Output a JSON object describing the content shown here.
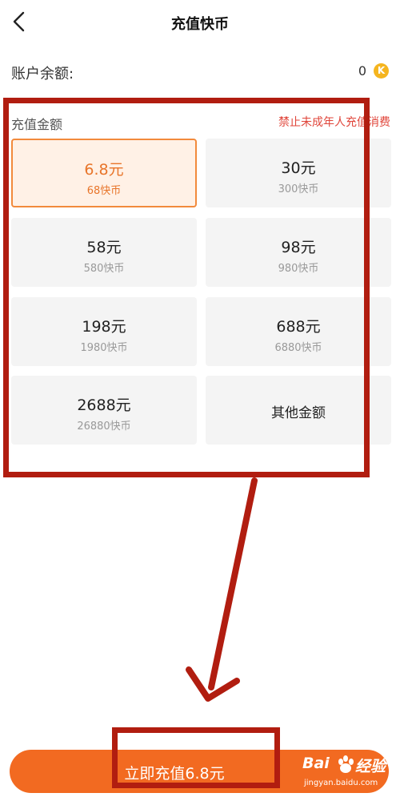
{
  "header": {
    "title": "充值快币",
    "back_icon": "chevron-left-icon"
  },
  "balance": {
    "label": "账户余额:",
    "value": "0",
    "coin_symbol": "K"
  },
  "section": {
    "label": "充值金额",
    "warning": "禁止未成年人充值消费"
  },
  "options": [
    {
      "amount": "6.8元",
      "coins": "68快币",
      "selected": true
    },
    {
      "amount": "30元",
      "coins": "300快币"
    },
    {
      "amount": "58元",
      "coins": "580快币"
    },
    {
      "amount": "98元",
      "coins": "980快币"
    },
    {
      "amount": "198元",
      "coins": "1980快币"
    },
    {
      "amount": "688元",
      "coins": "6880快币"
    },
    {
      "amount": "2688元",
      "coins": "26880快币"
    },
    {
      "other_label": "其他金额"
    }
  ],
  "recharge_button": {
    "label": "立即充值6.8元"
  },
  "watermark": {
    "brand": "Bai",
    "brand_suffix": "经验",
    "url": "jingyan.baidu.com"
  },
  "colors": {
    "accent": "#f26a21",
    "selected_border": "#f28a3c",
    "warning": "#e0453a",
    "annotation": "#b11d10",
    "coin": "#f5b51f"
  }
}
